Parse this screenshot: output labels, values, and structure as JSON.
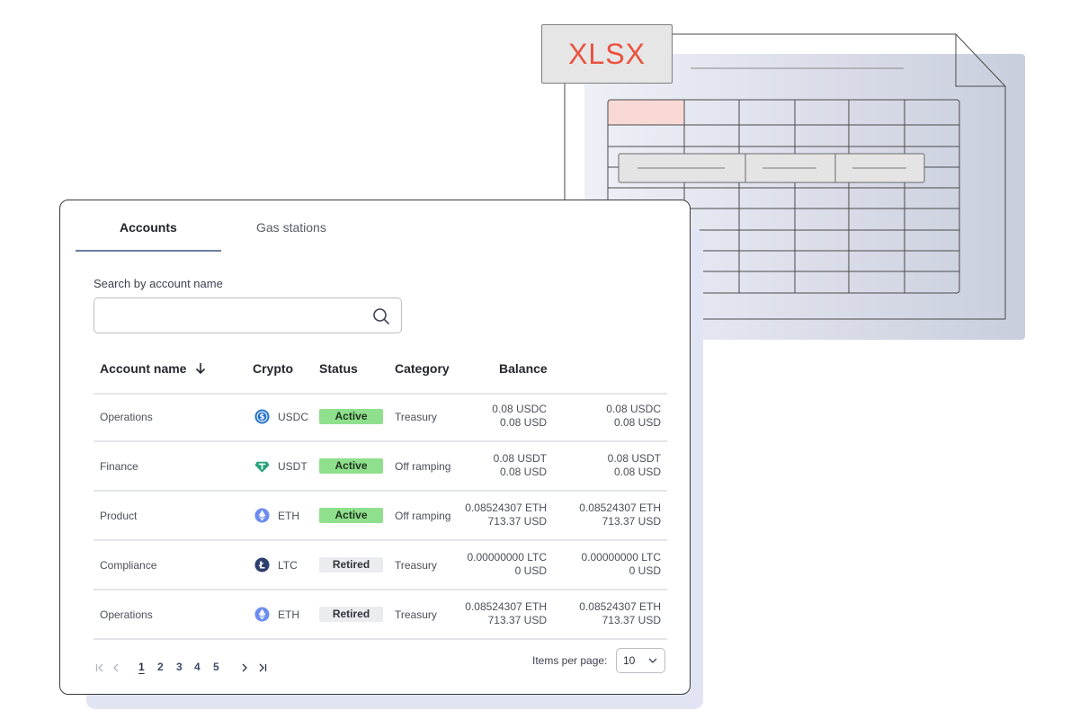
{
  "illustration": {
    "file_label": "XLSX",
    "label_color": "#e8533f"
  },
  "tabs": [
    {
      "label": "Accounts",
      "active": true
    },
    {
      "label": "Gas stations",
      "active": false
    }
  ],
  "search": {
    "label": "Search by account name",
    "value": "",
    "placeholder": ""
  },
  "table": {
    "columns": {
      "name": "Account name",
      "crypto": "Crypto",
      "status": "Status",
      "category": "Category",
      "balance": "Balance"
    },
    "rows": [
      {
        "name": "Operations",
        "crypto": "USDC",
        "crypto_icon": "usdc-icon",
        "status": "Active",
        "category": "Treasury",
        "bal1_line1": "0.08 USDC",
        "bal1_line2": "0.08 USD",
        "bal2_line1": "0.08 USDC",
        "bal2_line2": "0.08 USD"
      },
      {
        "name": "Finance",
        "crypto": "USDT",
        "crypto_icon": "usdt-icon",
        "status": "Active",
        "category": "Off ramping",
        "bal1_line1": "0.08 USDT",
        "bal1_line2": "0.08 USD",
        "bal2_line1": "0.08 USDT",
        "bal2_line2": "0.08 USD"
      },
      {
        "name": "Product",
        "crypto": "ETH",
        "crypto_icon": "eth-icon",
        "status": "Active",
        "category": "Off ramping",
        "bal1_line1": "0.08524307 ETH",
        "bal1_line2": "713.37 USD",
        "bal2_line1": "0.08524307 ETH",
        "bal2_line2": "713.37 USD"
      },
      {
        "name": "Compliance",
        "crypto": "LTC",
        "crypto_icon": "ltc-icon",
        "status": "Retired",
        "category": "Treasury",
        "bal1_line1": "0.00000000 LTC",
        "bal1_line2": "0 USD",
        "bal2_line1": "0.00000000 LTC",
        "bal2_line2": "0 USD"
      },
      {
        "name": "Operations",
        "crypto": "ETH",
        "crypto_icon": "eth-icon",
        "status": "Retired",
        "category": "Treasury",
        "bal1_line1": "0.08524307 ETH",
        "bal1_line2": "713.37 USD",
        "bal2_line1": "0.08524307 ETH",
        "bal2_line2": "713.37 USD"
      }
    ]
  },
  "pagination": {
    "pages": [
      "1",
      "2",
      "3",
      "4",
      "5"
    ],
    "current": "1",
    "items_per_page_label": "Items per page:",
    "items_per_page_value": "10"
  },
  "colors": {
    "active_badge": "#8fe08c",
    "retired_badge": "#ebecef",
    "usdc": "#2775ca",
    "usdt": "#26a17b",
    "eth": "#6b8cef",
    "ltc": "#2e3f6e"
  }
}
